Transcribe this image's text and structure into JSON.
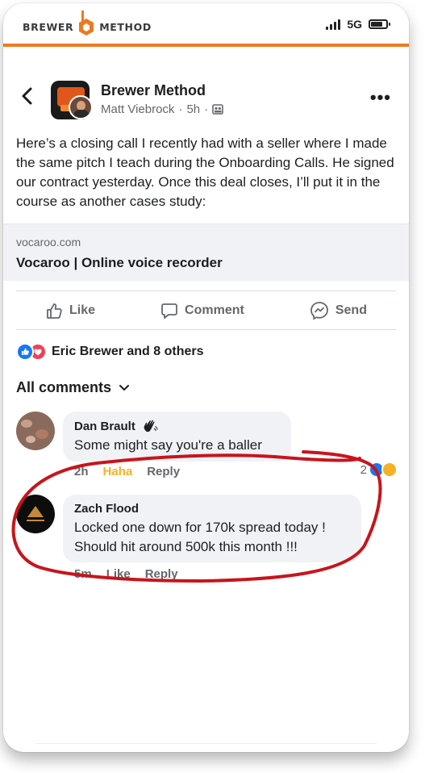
{
  "header": {
    "brand_left": "BREWER",
    "brand_right": "METHOD",
    "network": "5G",
    "accent_color": "#ec7a22"
  },
  "post": {
    "page_name": "Brewer Method",
    "author": "Matt Viebrock",
    "time": "5h",
    "separator": "·",
    "text": "Here’s a closing call I recently had with a seller where I made the same pitch I teach during the Onboarding Calls. He signed our contract yesterday. Once this deal closes, I’ll put it in the course as another cases study:",
    "link": {
      "domain": "vocaroo.com",
      "title": "Vocaroo | Online voice recorder"
    }
  },
  "actions": {
    "like": "Like",
    "comment": "Comment",
    "send": "Send"
  },
  "reactions": {
    "summary": "Eric Brewer and 8 others"
  },
  "comments_header": "All comments",
  "comments": [
    {
      "name": "Dan Brault",
      "text": "Some might say you're a baller",
      "time": "2h",
      "reaction_label": "Haha",
      "reply": "Reply",
      "reaction_count": "2"
    },
    {
      "name": "Zach Flood",
      "text": "Locked one down for 170k spread today ! Should hit around 500k this month !!!",
      "time": "5m",
      "like": "Like",
      "reply": "Reply"
    }
  ],
  "icons": {
    "back": "chevron-left-icon",
    "more": "more-icon",
    "audience": "group-icon",
    "like": "thumbs-up-icon",
    "comment": "comment-icon",
    "send": "messenger-icon",
    "dropdown": "chevron-down-icon",
    "wave_badge": "wave-icon"
  },
  "colors": {
    "like_blue": "#1877f2",
    "love_red": "#f33e58",
    "haha_yellow": "#f7b125",
    "annotation_red": "#c8141c"
  }
}
